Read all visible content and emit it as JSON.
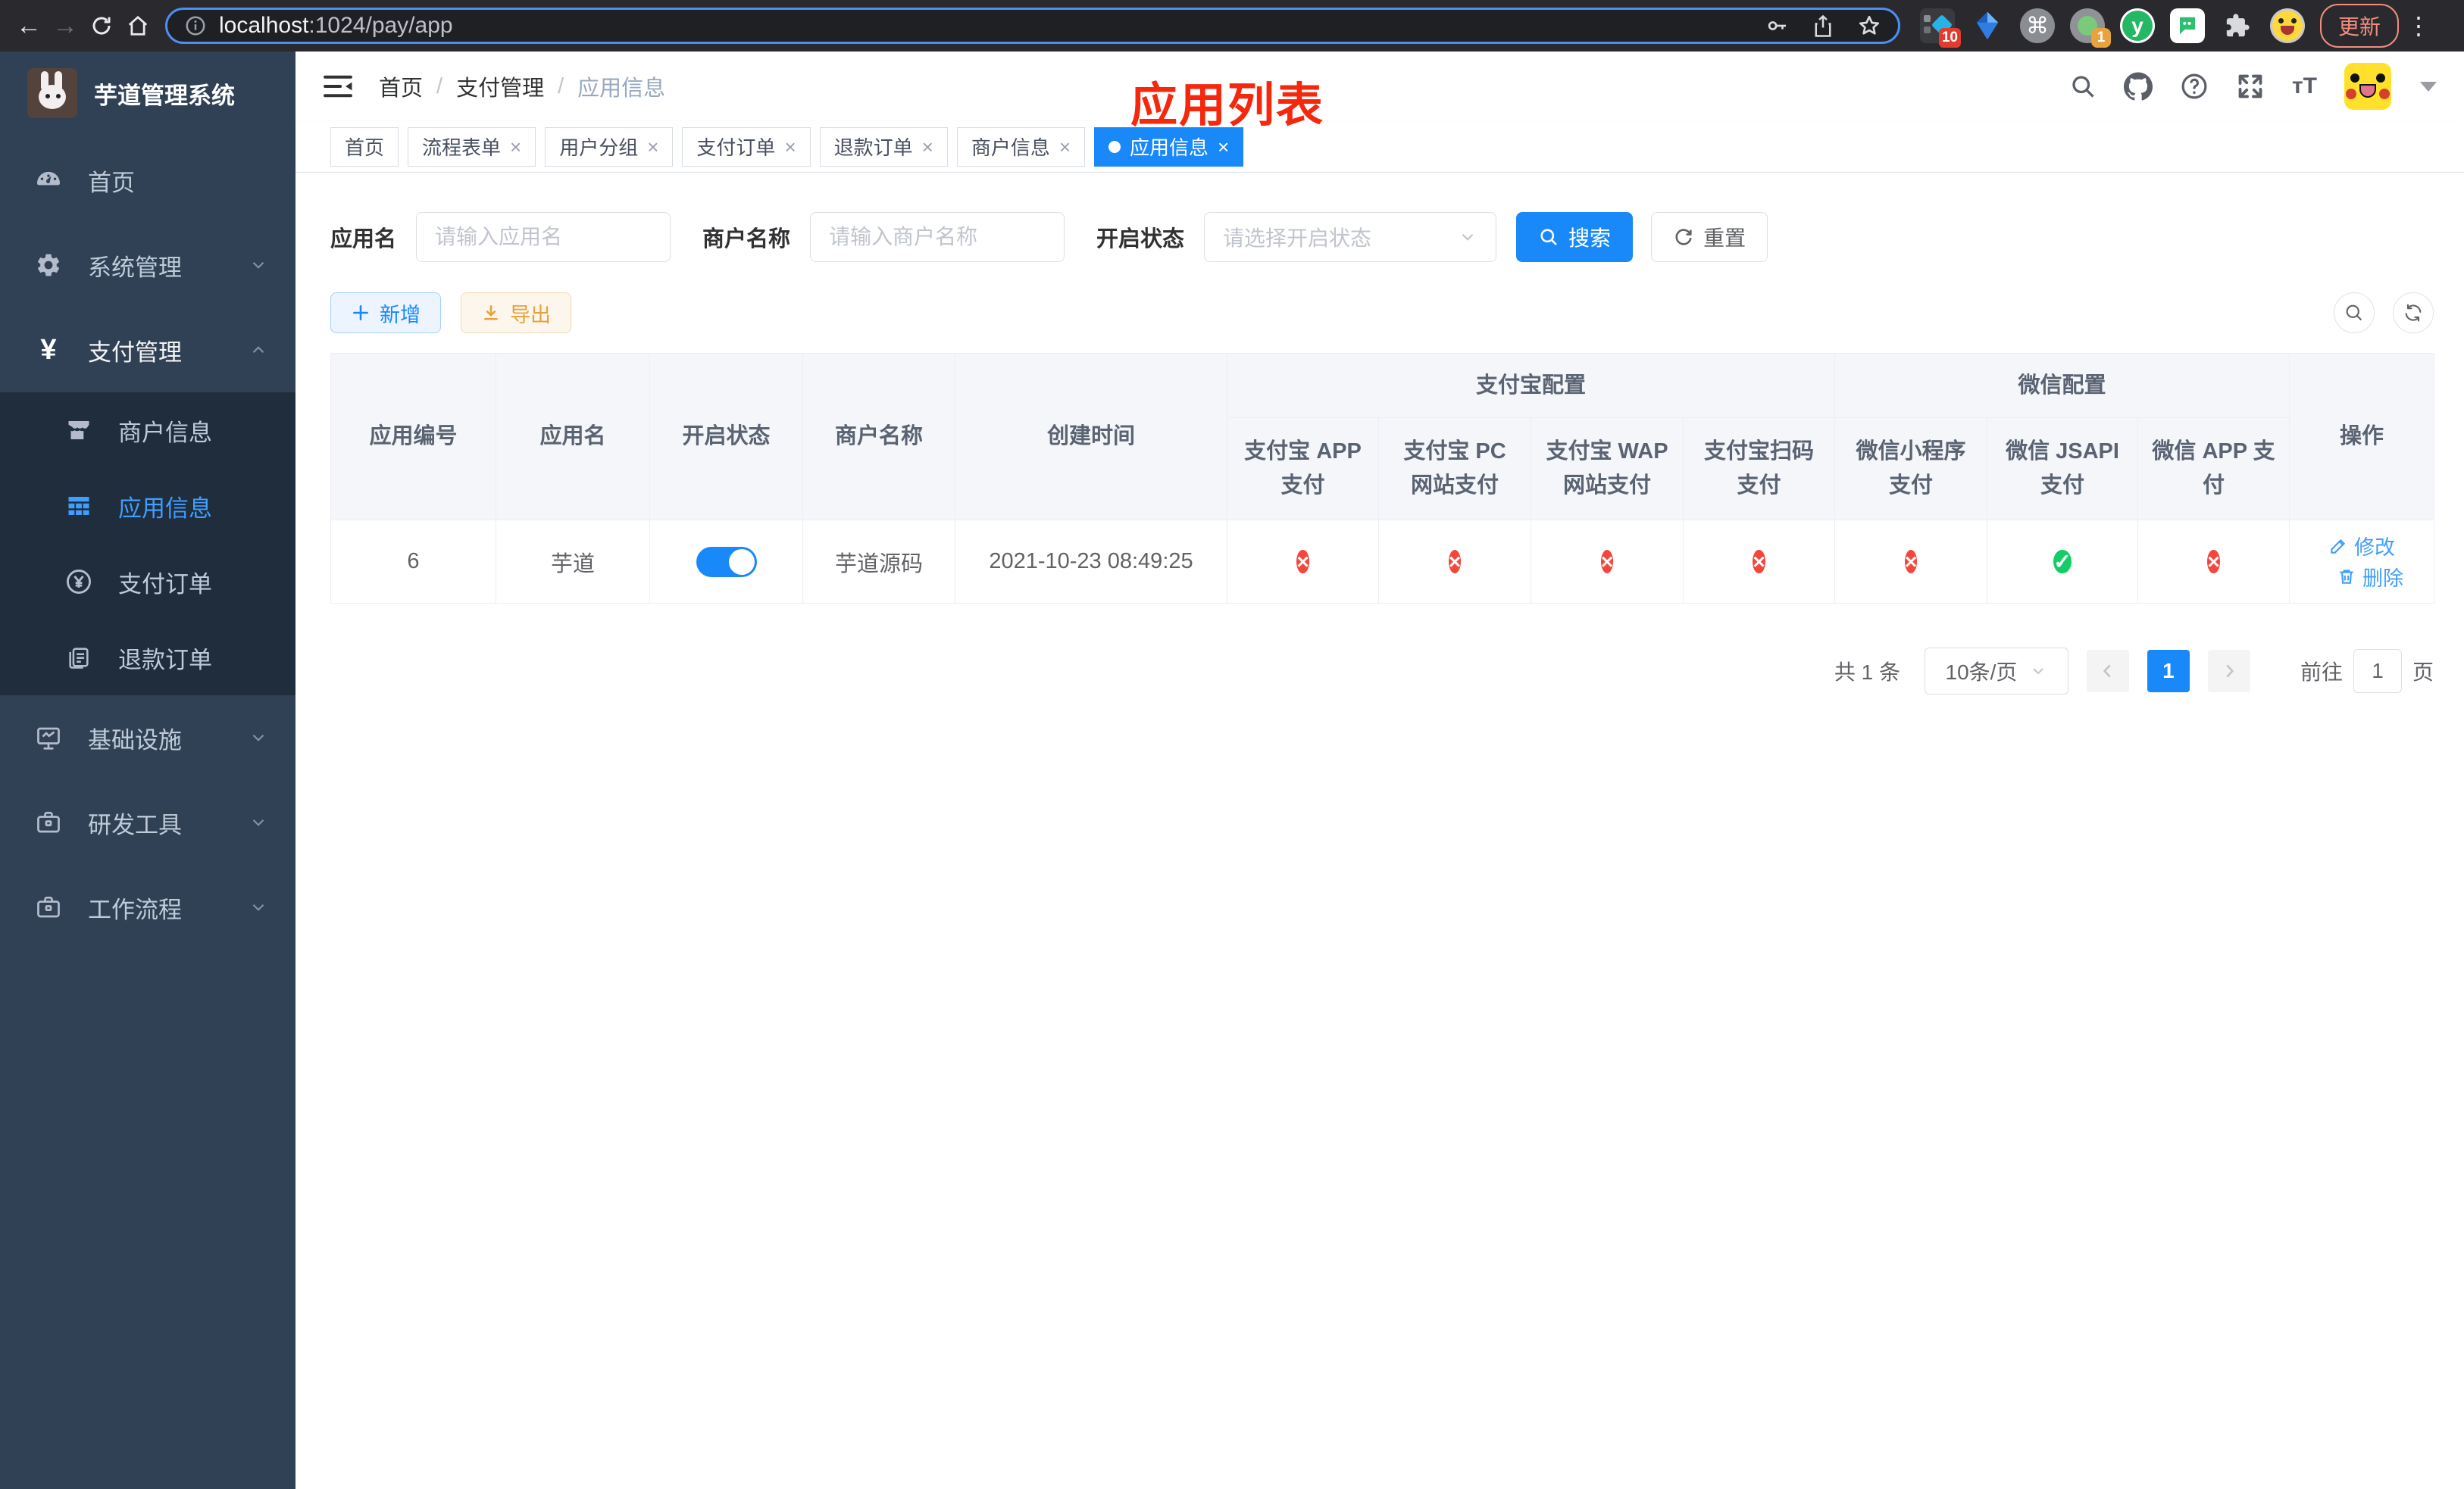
{
  "browser": {
    "url_host": "localhost",
    "url_rest": ":1024/pay/app",
    "update_label": "更新",
    "ext_badge_10": "10",
    "ext_badge_1": "1",
    "cmd_glyph": "⌘",
    "y_glyph": "y"
  },
  "sidebar": {
    "title": "芋道管理系统",
    "items": [
      {
        "label": "首页"
      },
      {
        "label": "系统管理"
      },
      {
        "label": "支付管理"
      },
      {
        "label": "商户信息"
      },
      {
        "label": "应用信息"
      },
      {
        "label": "支付订单"
      },
      {
        "label": "退款订单"
      },
      {
        "label": "基础设施"
      },
      {
        "label": "研发工具"
      },
      {
        "label": "工作流程"
      }
    ]
  },
  "header": {
    "breadcrumb": {
      "home": "首页",
      "section": "支付管理",
      "current": "应用信息",
      "separator": "/"
    },
    "annotation": "应用列表",
    "font_size_glyph": "тT"
  },
  "tabs": {
    "items": [
      {
        "label": "首页"
      },
      {
        "label": "流程表单"
      },
      {
        "label": "用户分组"
      },
      {
        "label": "支付订单"
      },
      {
        "label": "退款订单"
      },
      {
        "label": "商户信息"
      },
      {
        "label": "应用信息"
      }
    ],
    "close_glyph": "×"
  },
  "filters": {
    "app_name_label": "应用名",
    "app_name_placeholder": "请输入应用名",
    "merchant_label": "商户名称",
    "merchant_placeholder": "请输入商户名称",
    "status_label": "开启状态",
    "status_placeholder": "请选择开启状态",
    "search_label": "搜索",
    "reset_label": "重置"
  },
  "toolbar": {
    "add_label": "新增",
    "export_label": "导出"
  },
  "table": {
    "headers": {
      "col_id": "应用编号",
      "col_name": "应用名",
      "col_enabled": "开启状态",
      "col_merchant": "商户名称",
      "col_created": "创建时间",
      "group_alipay": "支付宝配置",
      "group_wechat": "微信配置",
      "col_alipay_app": "支付宝 APP 支付",
      "col_alipay_pc": "支付宝 PC 网站支付",
      "col_alipay_wap": "支付宝 WAP 网站支付",
      "col_alipay_qr": "支付宝扫码支付",
      "col_wx_lite": "微信小程序支付",
      "col_wx_jsapi": "微信 JSAPI 支付",
      "col_wx_app": "微信 APP 支付",
      "col_actions": "操作"
    },
    "row": {
      "id": "6",
      "name": "芋道",
      "enabled": true,
      "merchant": "芋道源码",
      "created": "2021-10-23 08:49:25",
      "statuses": [
        "error",
        "error",
        "error",
        "error",
        "error",
        "success",
        "error"
      ],
      "edit_label": "修改",
      "delete_label": "删除"
    }
  },
  "pagination": {
    "total": "共 1 条",
    "page_size": "10条/页",
    "page": "1",
    "goto_prefix": "前往",
    "goto_value": "1",
    "goto_suffix": "页"
  },
  "colors": {
    "accent": "#1989fa",
    "sidebar_active": "#409eff",
    "success": "#13ce66",
    "danger": "#f4473c",
    "annotation_red": "#f5270c"
  }
}
